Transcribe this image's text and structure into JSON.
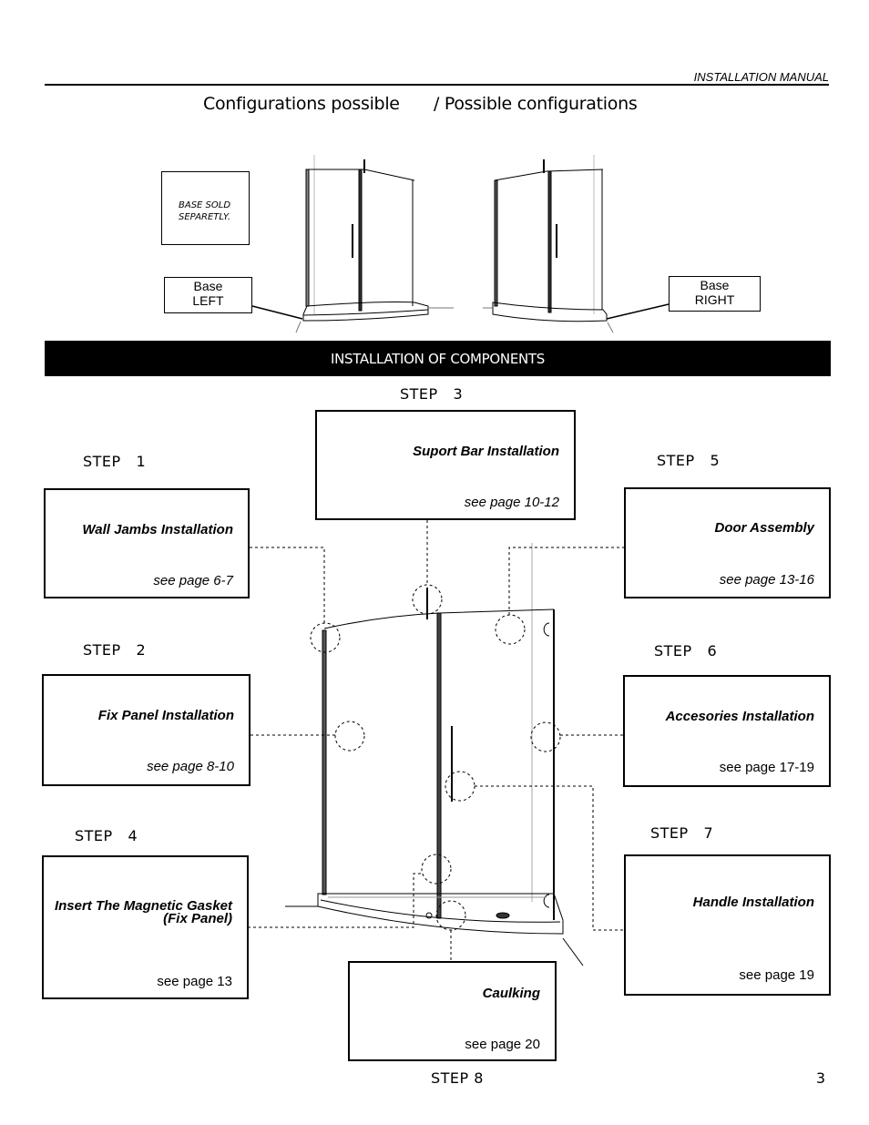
{
  "header": {
    "manual_label": "INSTALLATION MANUAL",
    "title_left": "Configurations possible",
    "title_right": "/ Possible  configurations"
  },
  "configurations": {
    "note": [
      "BASE SOLD",
      "SEPARETLY."
    ],
    "base_left": [
      "Base",
      "LEFT"
    ],
    "base_right": [
      "Base",
      "RIGHT"
    ]
  },
  "banner": {
    "label": "INSTALLATION OF  COMPONENTS"
  },
  "steps": [
    {
      "label": "STEP   1",
      "title": "Wall Jambs Installation",
      "page": "see page 6-7",
      "page_italic": true
    },
    {
      "label": "STEP   2",
      "title": "Fix Panel Installation",
      "page": "see page 8-10",
      "page_italic": true
    },
    {
      "label": "STEP   3",
      "title": "Suport Bar Installation",
      "page": "see page 10-12",
      "page_italic": true
    },
    {
      "label": "STEP   4",
      "title": "Insert The Magnetic Gasket",
      "title_line2": "(Fix Panel)",
      "page": "see page 13",
      "page_italic": false
    },
    {
      "label": "STEP   5",
      "title": "Door Assembly",
      "page": "see page 13-16",
      "page_italic": true
    },
    {
      "label": "STEP   6",
      "title": "Accesories Installation",
      "page": "see page 17-19",
      "page_italic": false
    },
    {
      "label": "STEP   7",
      "title": "Handle Installation",
      "page": "see page 19",
      "page_italic": false
    },
    {
      "label": "STEP 8",
      "title": "Caulking",
      "page": "see page 20",
      "page_italic": false
    }
  ],
  "footer": {
    "page_number": "3"
  }
}
